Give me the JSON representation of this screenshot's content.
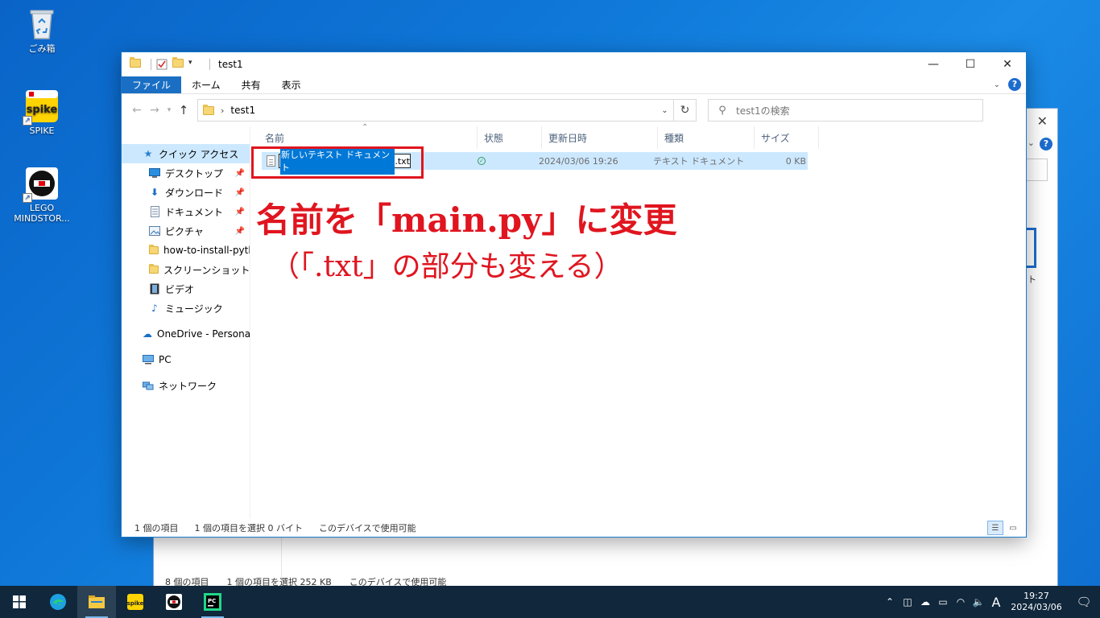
{
  "desktop": {
    "icons": [
      {
        "label": "ごみ箱"
      },
      {
        "label": "SPIKE"
      },
      {
        "label": "LEGO MINDSTOR..."
      }
    ]
  },
  "window": {
    "title": "test1",
    "controls": {
      "minimize": "—",
      "maximize": "☐",
      "close": "✕"
    },
    "ribbon_tabs": [
      "ファイル",
      "ホーム",
      "共有",
      "表示"
    ],
    "address": {
      "crumb": "test1"
    },
    "search": {
      "placeholder": "test1の検索"
    },
    "sidebar": {
      "quick_access": "クイック アクセス",
      "items": [
        "デスクトップ",
        "ダウンロード",
        "ドキュメント",
        "ピクチャ",
        "how-to-install-pyth",
        "スクリーンショット",
        "ビデオ",
        "ミュージック"
      ],
      "onedrive": "OneDrive - Personal",
      "pc": "PC",
      "network": "ネットワーク"
    },
    "columns": [
      "名前",
      "状態",
      "更新日時",
      "種類",
      "サイズ"
    ],
    "file": {
      "name_selected": "新しいテキスト ドキュメント",
      "name_ext": ".txt",
      "modified": "2024/03/06 19:26",
      "type": "テキスト ドキュメント",
      "size": "0 KB"
    },
    "status": {
      "count": "1 個の項目",
      "selected": "1 個の項目を選択 0 バイト",
      "availability": "このデバイスで使用可能"
    }
  },
  "annotation": {
    "line1": "名前を「main.py」に変更",
    "line2": "（「.txt」の部分も変える）",
    "color": "#e0151f"
  },
  "background_window": {
    "status": "8 個の項目　　1 個の項目を選択 252 KB　　このデバイスで使用可能",
    "thumb_label": "ット"
  },
  "taskbar": {
    "time": "19:27",
    "date": "2024/03/06",
    "ime": "A"
  }
}
